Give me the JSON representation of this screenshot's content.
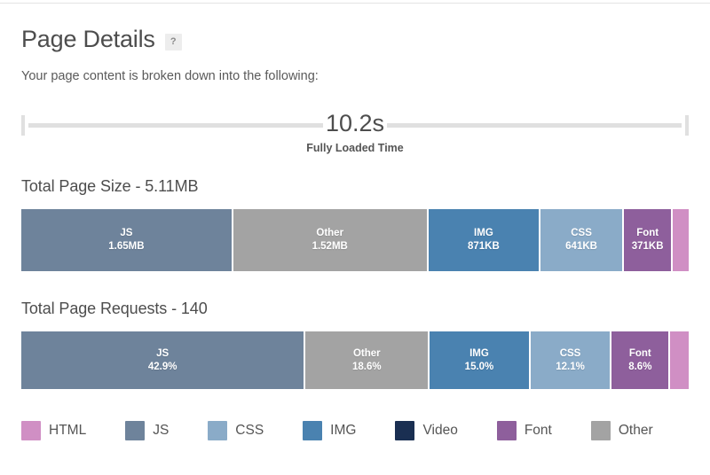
{
  "header": {
    "title": "Page Details",
    "help_badge": "?",
    "subtitle": "Your page content is broken down into the following:"
  },
  "fully_loaded": {
    "value": "10.2s",
    "label": "Fully Loaded Time"
  },
  "colors": {
    "html": "#d08fc4",
    "js": "#6e839b",
    "css": "#8aabc8",
    "img": "#4a82b0",
    "video": "#1a2f52",
    "font": "#8e5f9c",
    "other": "#a3a3a3",
    "heading_text": "#4d4d4d",
    "ruler": "#e0e0e0",
    "help_badge_bg": "#ededed"
  },
  "legend": {
    "items": [
      {
        "label": "HTML",
        "color_key": "html"
      },
      {
        "label": "JS",
        "color_key": "js"
      },
      {
        "label": "CSS",
        "color_key": "css"
      },
      {
        "label": "IMG",
        "color_key": "img"
      },
      {
        "label": "Video",
        "color_key": "video"
      },
      {
        "label": "Font",
        "color_key": "font"
      },
      {
        "label": "Other",
        "color_key": "other"
      }
    ]
  },
  "chart_data": [
    {
      "type": "bar",
      "id": "total-page-size",
      "orientation": "horizontal-stacked",
      "title": "Total Page Size - 5.11MB",
      "total_label": "5.11MB",
      "metric": "Total Page Size",
      "categories": [
        "JS",
        "Other",
        "IMG",
        "CSS",
        "Font",
        "HTML"
      ],
      "values": [
        1.65,
        1.52,
        0.871,
        0.641,
        0.371,
        0.123
      ],
      "value_labels": [
        "1.65MB",
        "1.52MB",
        "871KB",
        "641KB",
        "371KB",
        ""
      ],
      "unit": "MB",
      "percents": [
        32.3,
        29.7,
        17.0,
        12.5,
        7.3,
        2.4
      ],
      "colors": [
        "#6e839b",
        "#a3a3a3",
        "#4a82b0",
        "#8aabc8",
        "#8e5f9c",
        "#d08fc4"
      ],
      "show_labels_in_segment": [
        true,
        true,
        true,
        true,
        true,
        false
      ],
      "xlabel": "",
      "ylabel": "",
      "grid": false,
      "legend_position": "bottom"
    },
    {
      "type": "bar",
      "id": "total-page-requests",
      "orientation": "horizontal-stacked",
      "title": "Total Page Requests - 140",
      "total_label": "140",
      "metric": "Total Page Requests",
      "categories": [
        "JS",
        "Other",
        "IMG",
        "CSS",
        "Font",
        "HTML"
      ],
      "values": [
        42.9,
        18.6,
        15.0,
        12.1,
        8.6,
        2.8
      ],
      "value_labels": [
        "42.9%",
        "18.6%",
        "15.0%",
        "12.1%",
        "8.6%",
        ""
      ],
      "unit": "%",
      "percents": [
        42.9,
        18.6,
        15.0,
        12.1,
        8.6,
        2.8
      ],
      "colors": [
        "#6e839b",
        "#a3a3a3",
        "#4a82b0",
        "#8aabc8",
        "#8e5f9c",
        "#d08fc4"
      ],
      "show_labels_in_segment": [
        true,
        true,
        true,
        true,
        true,
        false
      ],
      "xlabel": "",
      "ylabel": "",
      "grid": false,
      "legend_position": "bottom"
    }
  ]
}
